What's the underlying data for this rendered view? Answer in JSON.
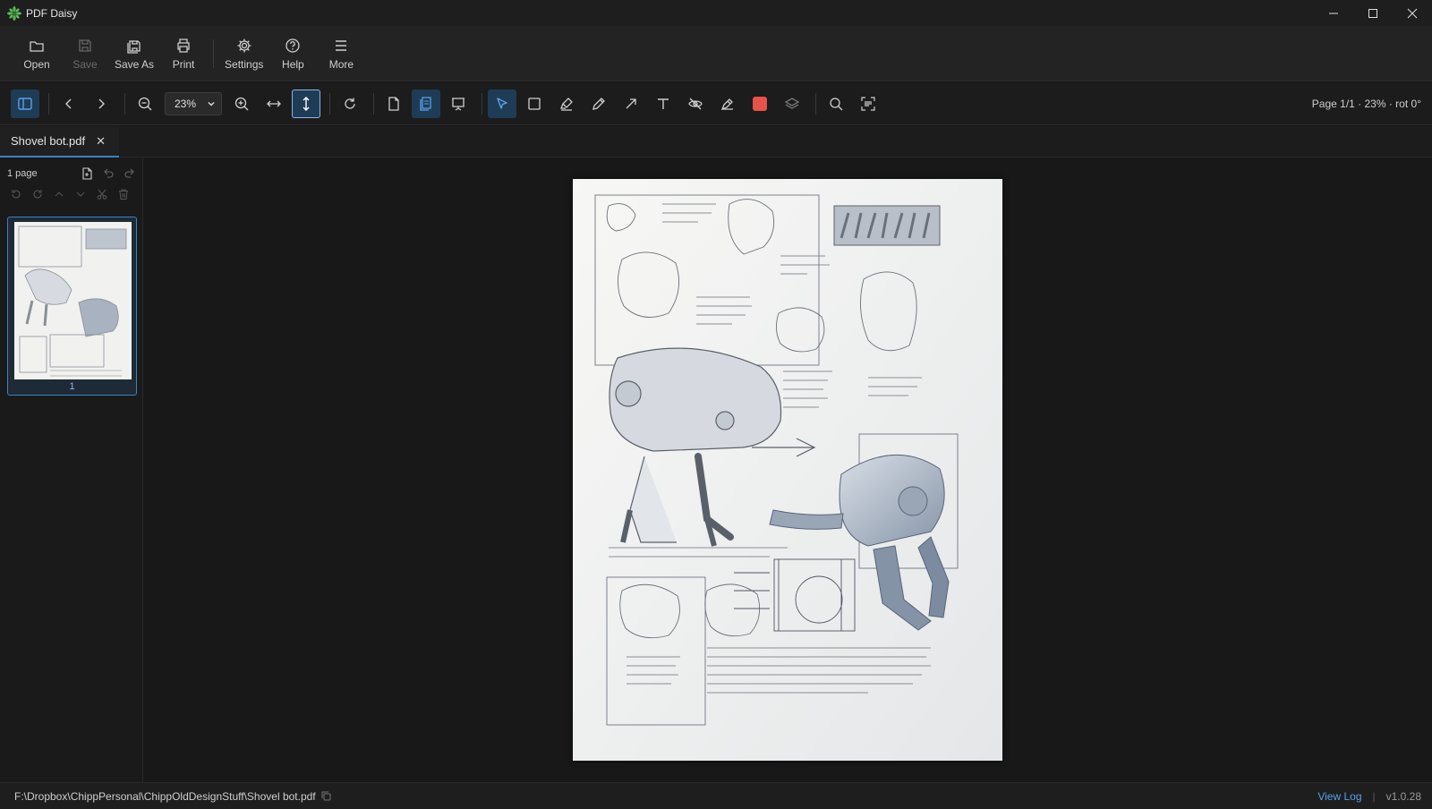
{
  "window": {
    "title": "PDF Daisy"
  },
  "ribbon": {
    "items": [
      {
        "label": "Open",
        "icon": "folder-open-icon",
        "disabled": false
      },
      {
        "label": "Save",
        "icon": "save-icon",
        "disabled": true
      },
      {
        "label": "Save As",
        "icon": "save-as-icon",
        "disabled": false
      },
      {
        "label": "Print",
        "icon": "printer-icon",
        "disabled": false
      },
      {
        "label": "Settings",
        "icon": "gear-icon",
        "disabled": false
      },
      {
        "label": "Help",
        "icon": "help-circle-icon",
        "disabled": false
      },
      {
        "label": "More",
        "icon": "menu-icon",
        "disabled": false
      }
    ]
  },
  "toolbar": {
    "zoom": "23%",
    "page_info": "Page 1/1 · 23% · rot 0°",
    "accent_color": "#3b82c4",
    "annotation_color": "#e5534b"
  },
  "tabs": [
    {
      "label": "Shovel bot.pdf",
      "close": "✕"
    }
  ],
  "sidebar": {
    "page_count": "1 page",
    "thumbnails": [
      {
        "number": "1"
      }
    ]
  },
  "status": {
    "path": "F:\\Dropbox\\ChippPersonal\\ChippOldDesignStuff\\Shovel bot.pdf",
    "view_log": "View Log",
    "divider": "|",
    "version": "v1.0.28"
  }
}
